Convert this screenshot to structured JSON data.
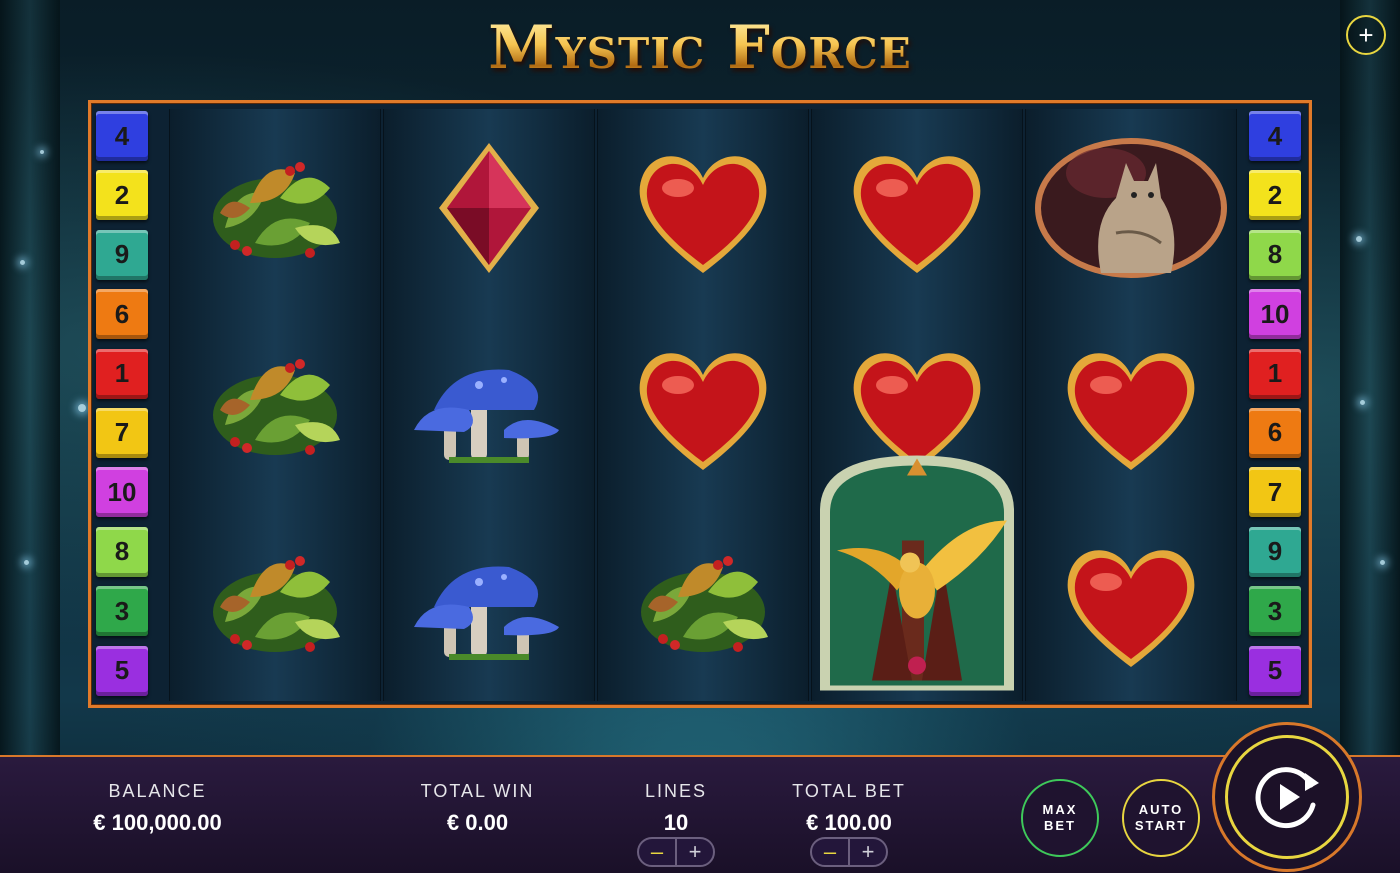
{
  "game": {
    "title": "Mystic Force"
  },
  "top_controls": {
    "menu_plus": "+"
  },
  "paylines": {
    "left": [
      "4",
      "2",
      "9",
      "6",
      "1",
      "7",
      "10",
      "8",
      "3",
      "5"
    ],
    "right": [
      "4",
      "2",
      "8",
      "10",
      "1",
      "6",
      "7",
      "9",
      "3",
      "5"
    ]
  },
  "reels": [
    [
      "leaf-bush",
      "leaf-bush",
      "leaf-bush"
    ],
    [
      "diamond",
      "mushroom",
      "mushroom"
    ],
    [
      "heart",
      "heart",
      "leaf-bush"
    ],
    [
      "heart",
      "heart",
      "eagle-wild"
    ],
    [
      "lynx",
      "heart",
      "heart"
    ]
  ],
  "bottom_bar": {
    "balance_label": "BALANCE",
    "balance_value": "€ 100,000.00",
    "total_win_label": "TOTAL WIN",
    "total_win_value": "€ 0.00",
    "lines_label": "LINES",
    "lines_value": "10",
    "total_bet_label": "TOTAL BET",
    "total_bet_value": "€ 100.00",
    "minus": "–",
    "plus": "+",
    "max_bet_line1": "MAX",
    "max_bet_line2": "BET",
    "auto_start_line1": "AUTO",
    "auto_start_line2": "START"
  },
  "colors": {
    "frame": "#e07a2a",
    "accent_yellow": "#e8d640",
    "max_bet_ring": "#3ec95a",
    "bar_bg": "#2a1a3e"
  }
}
